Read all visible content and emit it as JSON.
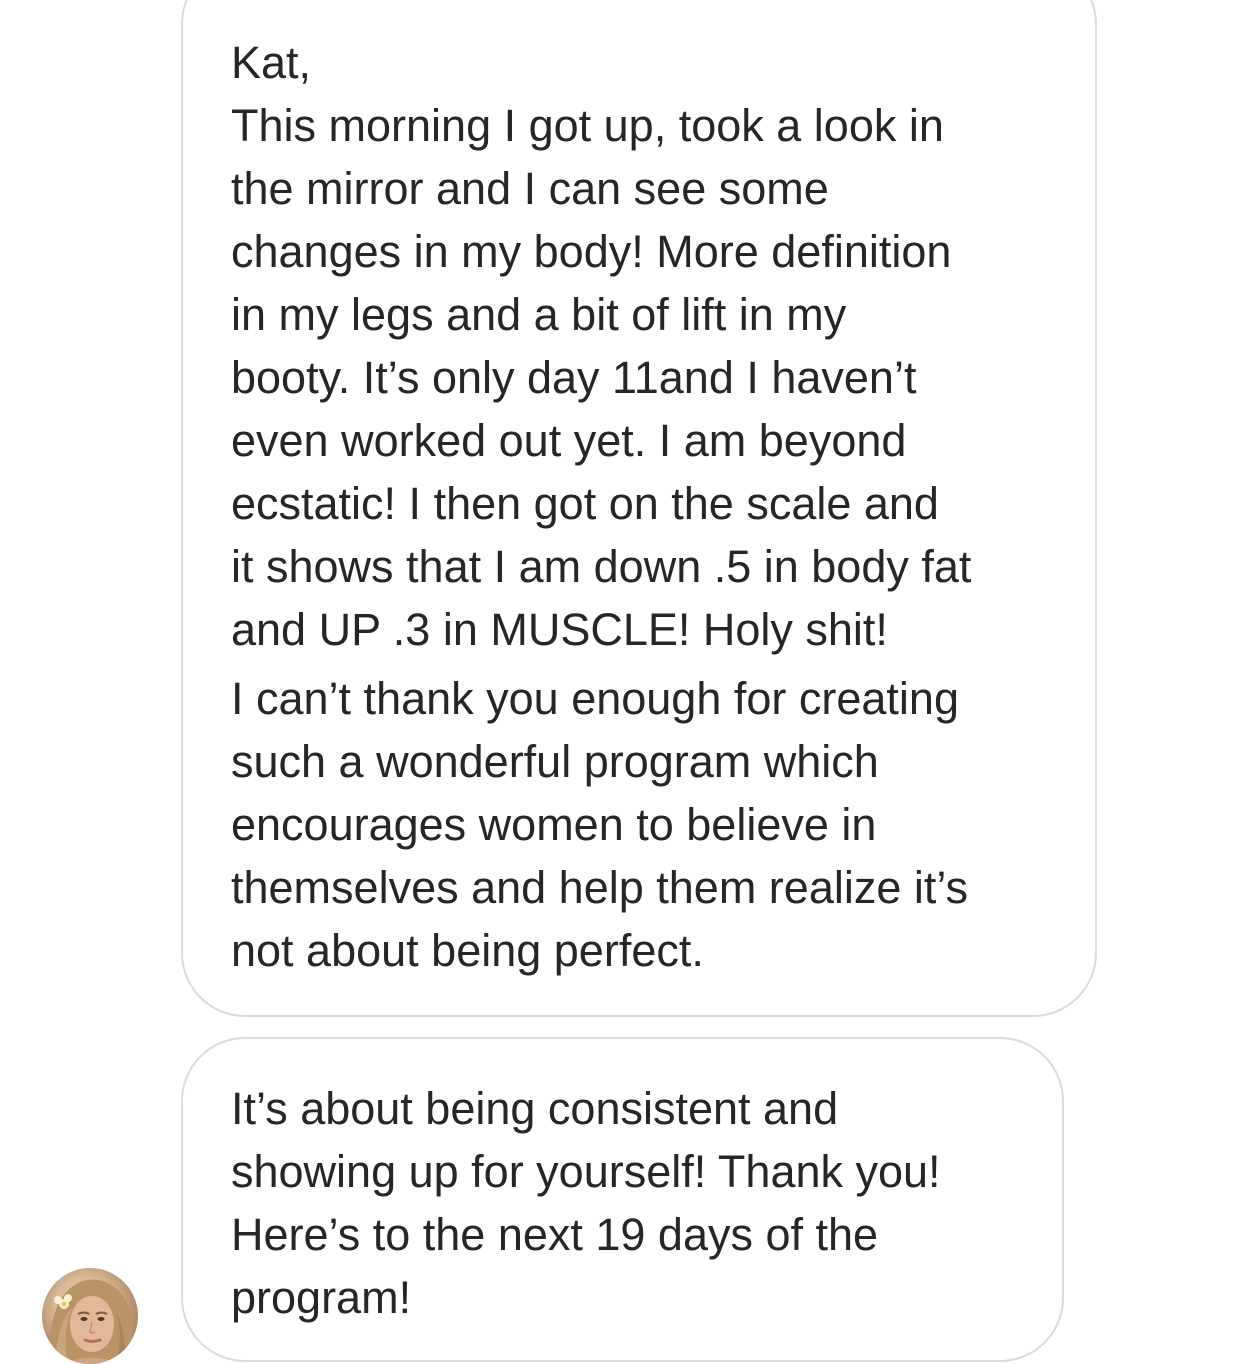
{
  "conversation": {
    "messages": [
      {
        "lines": [
          "Kat,",
          "This morning I got up, took a look in",
          "the mirror and I can see some",
          "changes in my body! More definition",
          "in my legs and a bit of lift in my",
          "booty. It’s only day 11and I haven’t",
          "even worked out yet. I am beyond",
          "ecstatic! I then got on the scale and",
          "it shows that I am down .5 in body fat",
          "and UP .3 in MUSCLE! Holy shit!",
          "I can’t thank you enough for creating",
          "such a wonderful program which",
          "encourages women to believe in",
          "themselves and help them realize it’s",
          "not about being perfect."
        ]
      },
      {
        "lines": [
          "It’s about being consistent and",
          "showing up for yourself! Thank you!",
          "Here’s to the next 19 days of the",
          "program!"
        ]
      }
    ],
    "sender": {
      "avatar_icon": "profile-photo"
    }
  }
}
